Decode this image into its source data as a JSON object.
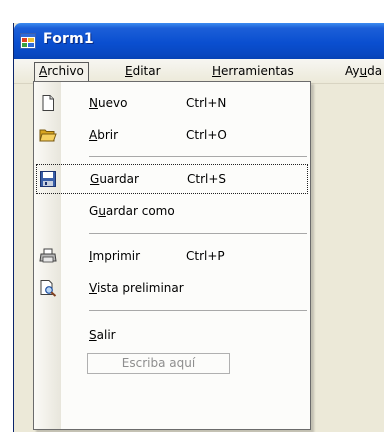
{
  "window": {
    "title": "Form1"
  },
  "menubar": {
    "items": [
      {
        "label": "Archivo"
      },
      {
        "label": "Editar"
      },
      {
        "label": "Herramientas"
      },
      {
        "label": "Ayuda"
      }
    ]
  },
  "file_menu": {
    "nuevo": {
      "label": "Nuevo",
      "shortcut": "Ctrl+N",
      "icon": "new-document-icon"
    },
    "abrir": {
      "label": "Abrir",
      "shortcut": "Ctrl+O",
      "icon": "open-folder-icon"
    },
    "guardar": {
      "label": "Guardar",
      "shortcut": "Ctrl+S",
      "icon": "save-disk-icon"
    },
    "guardar_como": {
      "label": "Guardar como"
    },
    "imprimir": {
      "label": "Imprimir",
      "shortcut": "Ctrl+P",
      "icon": "printer-icon"
    },
    "vista_preliminar": {
      "label": "Vista preliminar",
      "icon": "print-preview-icon"
    },
    "salir": {
      "label": "Salir"
    },
    "type_here": "Escriba aquí"
  },
  "colors": {
    "titlebar": "#0a4fd0",
    "window_bg": "#ece9d8",
    "menu_bg": "#fcfcfa",
    "separator": "#a8a8a8",
    "placeholder_text": "#8e8e8e"
  }
}
